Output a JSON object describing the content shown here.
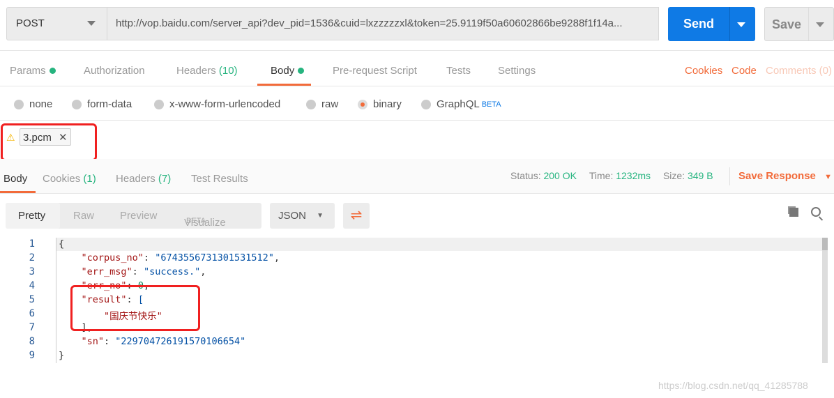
{
  "request": {
    "method": "POST",
    "url": "http://vop.baidu.com/server_api?dev_pid=1536&cuid=lxzzzzzxl&token=25.9119f50a60602866be9288f1f14a...",
    "send_label": "Send",
    "save_label": "Save"
  },
  "req_tabs": {
    "params": "Params",
    "authorization": "Authorization",
    "headers": "Headers",
    "headers_count": "(10)",
    "body": "Body",
    "prerequest": "Pre-request Script",
    "tests": "Tests",
    "settings": "Settings",
    "cookies": "Cookies",
    "code": "Code",
    "comments": "Comments (0)"
  },
  "body_types": {
    "none": "none",
    "form_data": "form-data",
    "urlencoded": "x-www-form-urlencoded",
    "raw": "raw",
    "binary": "binary",
    "graphql": "GraphQL",
    "beta": "BETA",
    "selected": "binary"
  },
  "file": {
    "name": "3.pcm"
  },
  "res_tabs": {
    "body": "Body",
    "cookies": "Cookies",
    "cookies_count": "(1)",
    "headers": "Headers",
    "headers_count": "(7)",
    "test_results": "Test Results"
  },
  "status": {
    "status_label": "Status:",
    "status": "200 OK",
    "time_label": "Time:",
    "time": "1232ms",
    "size_label": "Size:",
    "size": "349 B",
    "save_response": "Save Response"
  },
  "view": {
    "pretty": "Pretty",
    "raw": "Raw",
    "preview": "Preview",
    "visualize": "Visualize",
    "beta": "BETA",
    "format": "JSON"
  },
  "lines": [
    "1",
    "2",
    "3",
    "4",
    "5",
    "6",
    "7",
    "8",
    "9"
  ],
  "json": {
    "corpus_no_key": "\"corpus_no\"",
    "corpus_no": "\"6743556731301531512\"",
    "err_msg_key": "\"err_msg\"",
    "err_msg": "\"success.\"",
    "err_no_key": "\"err_no\"",
    "err_no": "0",
    "result_key": "\"result\"",
    "result_0": "\"国庆节快乐\"",
    "sn_key": "\"sn\"",
    "sn": "\"229704726191570106654\""
  },
  "watermark": "https://blog.csdn.net/qq_41285788"
}
